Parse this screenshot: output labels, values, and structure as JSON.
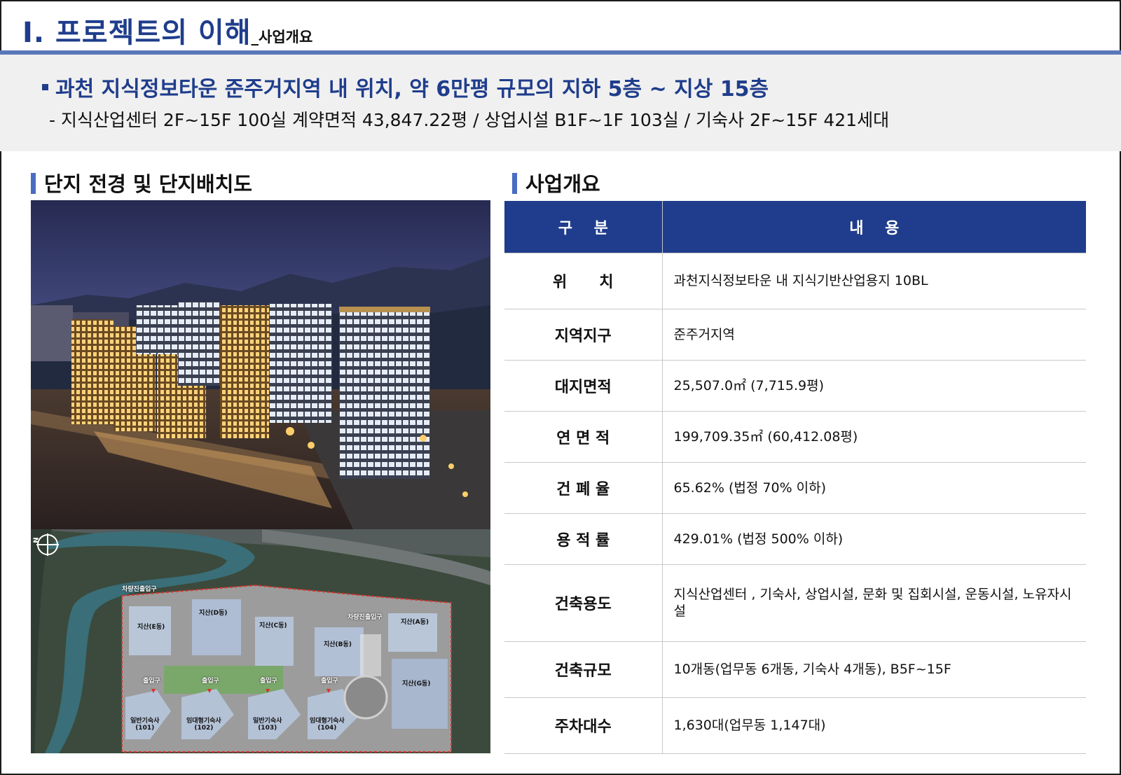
{
  "header": {
    "title": "Ⅰ. 프로젝트의 이해",
    "subtitle": "_사업개요"
  },
  "summary": {
    "headline": "과천 지식정보타운 준주거지역 내 위치, 약 6만평 규모의 지하 5층 ~ 지상 15층",
    "detail": "- 지식산업센터 2F~15F 100실 계약면적 43,847.22평 /  상업시설 B1F~1F 103실 / 기숙사 2F~15F 421세대"
  },
  "left_section": {
    "title": "단지 전경 및 단지배치도"
  },
  "site_plan": {
    "compass": "N",
    "labels": {
      "vehicle_entry_1": "차량진출입구",
      "vehicle_entry_2": "차량진출입구",
      "bldg_e": "지산(E동)",
      "bldg_d": "지산(D동)",
      "bldg_c": "지산(C동)",
      "bldg_b": "지산(B동)",
      "bldg_a": "지산(A동)",
      "bldg_g": "지산(G동)",
      "entrance_1": "출입구",
      "entrance_2": "출입구",
      "entrance_3": "출입구",
      "entrance_4": "출입구",
      "dorm_101": "일반기숙사\n(101)",
      "dorm_102": "임대형기숙사\n(102)",
      "dorm_103": "일반기숙사\n(103)",
      "dorm_104": "임대형기숙사\n(104)"
    }
  },
  "right_section": {
    "title": "사업개요"
  },
  "table": {
    "headers": [
      "구    분",
      "내    용"
    ],
    "rows": [
      {
        "label": "위      치",
        "value": "과천지식정보타운 내 지식기반산업용지 10BL"
      },
      {
        "label": "지역지구",
        "value": "준주거지역"
      },
      {
        "label": "대지면적",
        "value": "25,507.0㎡ (7,715.9평)"
      },
      {
        "label": "연 면 적",
        "value": "199,709.35㎡ (60,412.08평)"
      },
      {
        "label": "건 폐 율",
        "value": "65.62% (법정 70% 이하)"
      },
      {
        "label": "용 적 률",
        "value": "429.01% (법정 500% 이하)"
      },
      {
        "label": "건축용도",
        "value": "지식산업센터 , 기숙사,  상업시설, 문화 및 집회시설, 운동시설, 노유자시설"
      },
      {
        "label": "건축규모",
        "value": "10개동(업무동 6개동, 기숙사 4개동), B5F~15F"
      },
      {
        "label": "주차대수",
        "value": "1,630대(업무동 1,147대)"
      }
    ]
  },
  "colors": {
    "primary_navy": "#1f3d8c",
    "accent_blue": "#4a6cc4",
    "rule_blue": "#5a78b8",
    "band_gray": "#f0f0f0"
  }
}
